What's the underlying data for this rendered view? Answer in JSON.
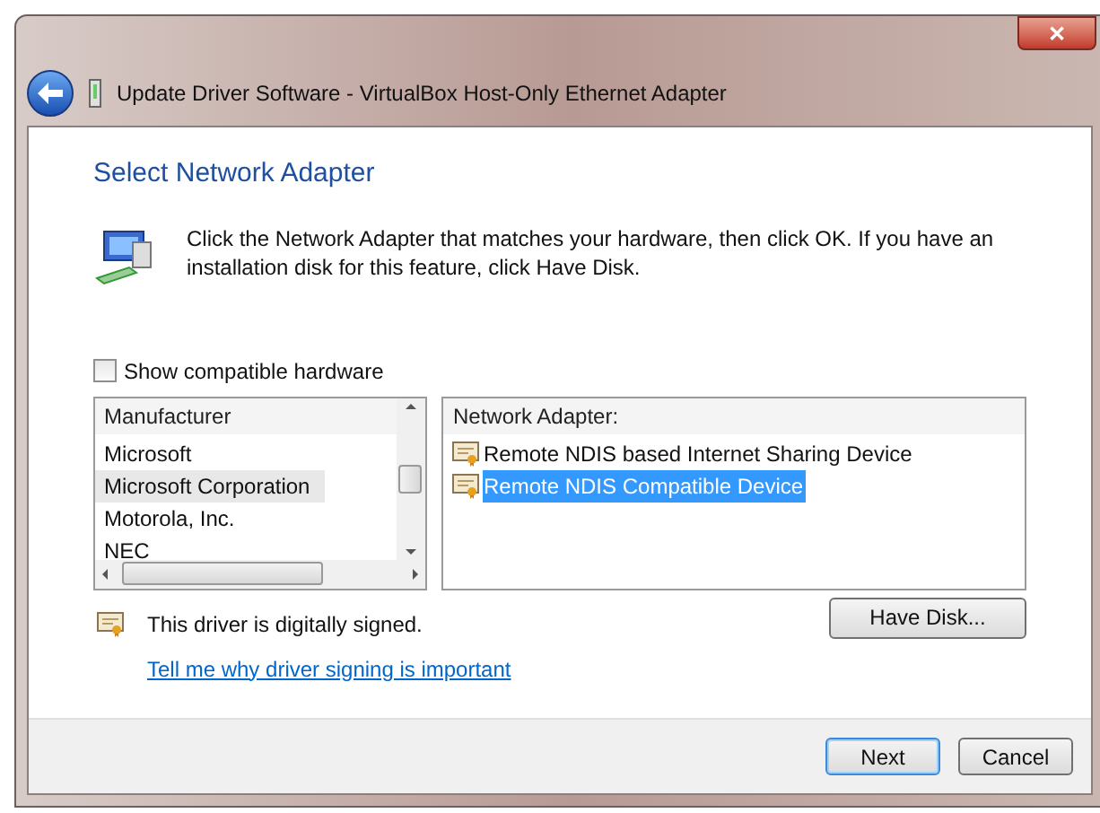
{
  "window": {
    "title": "Update Driver Software - VirtualBox Host-Only Ethernet Adapter",
    "close": "✕"
  },
  "heading": "Select Network Adapter",
  "instructions": "Click the Network Adapter that matches your hardware, then click OK. If you have an installation disk for this feature, click Have Disk.",
  "show_compatible": {
    "label": "Show compatible hardware",
    "checked": false
  },
  "manufacturers": {
    "header": "Manufacturer",
    "items": [
      {
        "label": "Microsoft",
        "selected": false
      },
      {
        "label": "Microsoft Corporation",
        "selected": true
      },
      {
        "label": "Motorola, Inc.",
        "selected": false
      },
      {
        "label": "NEC",
        "selected": false
      }
    ]
  },
  "adapters": {
    "header": "Network Adapter:",
    "items": [
      {
        "label": "Remote NDIS based Internet Sharing Device",
        "selected": false
      },
      {
        "label": "Remote NDIS Compatible Device",
        "selected": true
      }
    ]
  },
  "signed_text": "This driver is digitally signed.",
  "signing_link": "Tell me why driver signing is important",
  "have_disk_button": "Have Disk...",
  "buttons": [
    {
      "label": "Next",
      "default": true
    },
    {
      "label": "Cancel",
      "default": false
    }
  ]
}
